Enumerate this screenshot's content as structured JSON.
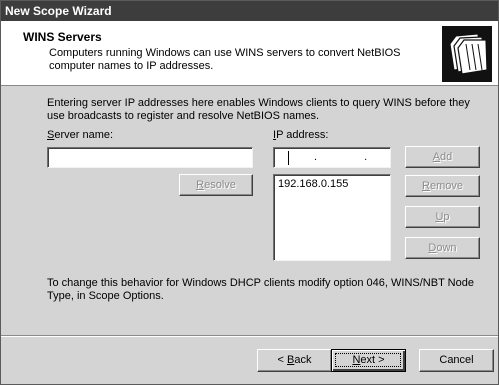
{
  "window": {
    "title": "New Scope Wizard"
  },
  "header": {
    "title": "WINS Servers",
    "description": "Computers running Windows can use WINS servers to convert NetBIOS computer names to IP addresses.",
    "icon": "folders-icon"
  },
  "body": {
    "intro": "Entering server IP addresses here enables Windows clients to query WINS before they use broadcasts to register and resolve NetBIOS names.",
    "server_name_label_pre": "",
    "server_name_label_u": "S",
    "server_name_label_post": "erver name:",
    "server_name_value": "",
    "ip_label_pre": "",
    "ip_label_u": "I",
    "ip_label_post": "P address:",
    "ip_value": ". . .",
    "resolve_pre": "",
    "resolve_u": "R",
    "resolve_post": "esolve",
    "add_pre": "",
    "add_u": "A",
    "add_post": "dd",
    "remove_pre": "",
    "remove_u": "R",
    "remove_post": "emove",
    "up_pre": "",
    "up_u": "U",
    "up_post": "p",
    "down_pre": "",
    "down_u": "D",
    "down_post": "own",
    "servers": [
      "192.168.0.155"
    ],
    "footer_note": "To change this behavior for Windows DHCP clients modify option 046, WINS/NBT Node Type, in Scope Options."
  },
  "buttons": {
    "back_pre": "< ",
    "back_u": "B",
    "back_post": "ack",
    "next_pre": "",
    "next_u": "N",
    "next_post": "ext >",
    "cancel": "Cancel"
  },
  "colors": {
    "titlebar": "#3d3d3d",
    "dialog": "#d4d4d4"
  }
}
